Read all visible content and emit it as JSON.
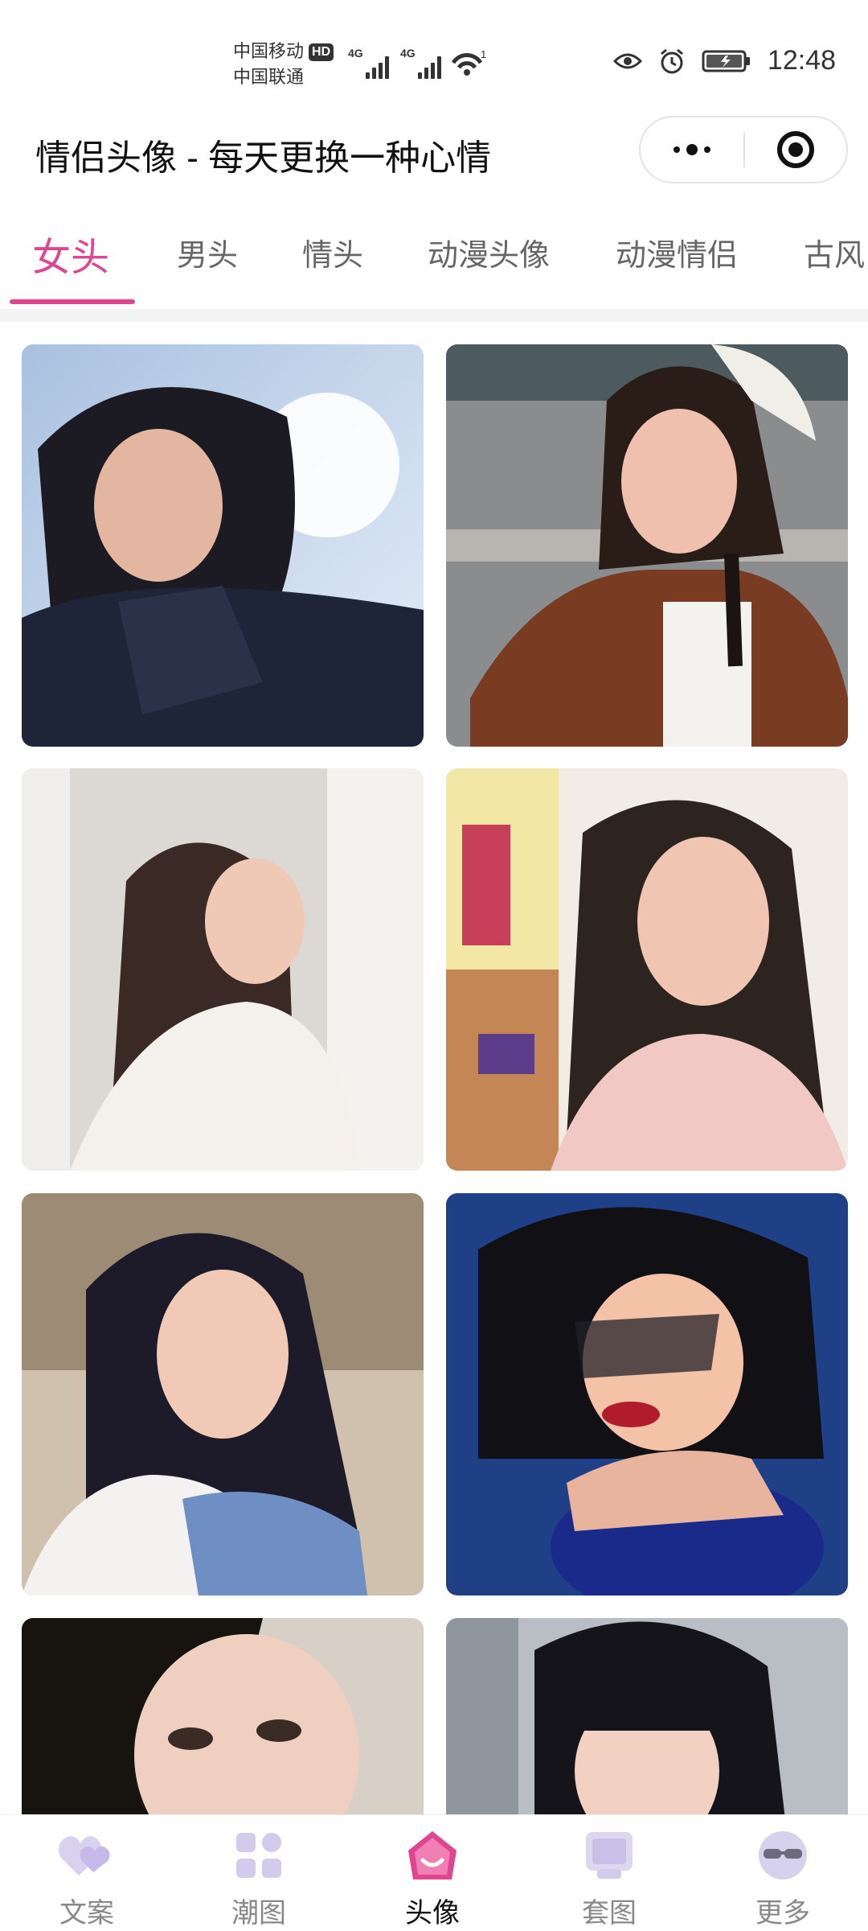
{
  "status_bar": {
    "carrier_1": "中国移动",
    "carrier_2": "中国联通",
    "hd": "HD",
    "network_1": "4G",
    "network_2": "4G",
    "wifi_badge": "1",
    "time": "12:48",
    "icons": [
      "eye-icon",
      "alarm-icon",
      "battery-charging-icon"
    ]
  },
  "header": {
    "title": "情侣头像 - 每天更换一种心情",
    "capsule_icons": [
      "more-dots-icon",
      "close-target-icon"
    ]
  },
  "tabs": {
    "items": [
      "女头",
      "男头",
      "情头",
      "动漫头像",
      "动漫情侣",
      "古风"
    ],
    "active_index": 0,
    "accent_color": "#e0468f"
  },
  "gallery": {
    "columns": 2,
    "items": [
      "portrait-1",
      "portrait-2",
      "portrait-3",
      "portrait-4",
      "portrait-5",
      "portrait-6",
      "portrait-7",
      "portrait-8"
    ]
  },
  "bottom_nav": {
    "items": [
      {
        "label": "文案",
        "icon": "hearts-icon"
      },
      {
        "label": "潮图",
        "icon": "grid-icon"
      },
      {
        "label": "头像",
        "icon": "smile-house-icon"
      },
      {
        "label": "套图",
        "icon": "photo-set-icon"
      },
      {
        "label": "更多",
        "icon": "sunglasses-icon"
      }
    ],
    "active_index": 2,
    "active_color": "#e0468f",
    "inactive_color": "#c9c1e6"
  }
}
